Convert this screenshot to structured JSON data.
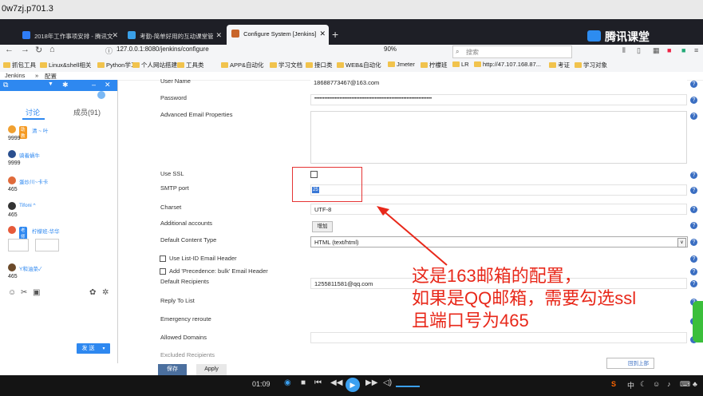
{
  "window_title": "0w7zj.p701.3",
  "tabs": [
    {
      "label": "2018年工作事项安排 - 腾讯文",
      "color": "#2f7df6"
    },
    {
      "label": "考勤-简单好用的互动课堂管",
      "color": "#3aa0e8"
    },
    {
      "label": "Configure System [Jenkins]",
      "color": "#c8652a"
    }
  ],
  "brand": "腾讯课堂",
  "address": {
    "url": "127.0.0.1:8080/jenkins/configure",
    "zoom": "90%",
    "search_placeholder": "搜索"
  },
  "bookmarks": [
    "抓包工具",
    "Linux&shell相关",
    "Python学习",
    "个人网站搭建",
    "工具类",
    "APP&自动化",
    "学习文档",
    "接口类",
    "WEB&自动化",
    "Jmeter",
    "柠檬班",
    "LR",
    "http://47.107.168.87...",
    "考证",
    "学习对象"
  ],
  "breadcrumb": {
    "root": "Jenkins",
    "sep": "»",
    "page": "配置"
  },
  "form": {
    "user_name_label": "User Name",
    "user_name_value": "18688773467@163.com",
    "password_label": "Password",
    "password_value": "••••••••••••••••••••••••••••••••••••••••••••••••••••••••••••••••••••••",
    "adv_props_label": "Advanced Email Properties",
    "use_ssl_label": "Use SSL",
    "use_ssl_checked": false,
    "smtp_port_label": "SMTP port",
    "smtp_port_value": "25",
    "charset_label": "Charset",
    "charset_value": "UTF-8",
    "additional_accounts_label": "Additional accounts",
    "add_button": "增加",
    "content_type_label": "Default Content Type",
    "content_type_value": "HTML (text/html)",
    "use_list_id_label": "Use List-ID Email Header",
    "add_precedence_label": "Add 'Precedence: bulk' Email Header",
    "recipients_label": "Default Recipients",
    "recipients_value": "1255811581@qq.com",
    "reply_to_label": "Reply To List",
    "emergency_label": "Emergency reroute",
    "allowed_domains_label": "Allowed Domains",
    "excluded_label": "Excluded Recipients",
    "save_button": "保存",
    "apply_button": "Apply",
    "back_top": "回到上部",
    "help_glyph": "?"
  },
  "annotation": [
    "这是163邮箱的配置，",
    "如果是QQ邮箱，需要勾选ssl",
    "且端口号为465"
  ],
  "chat": {
    "tab_discuss": "讨论",
    "tab_members": "成员(91)",
    "send_button": "发 送",
    "messages": [
      {
        "tag": "助教",
        "name": "清 ~ 叶",
        "text": "9999",
        "avatar_color": "#f0a030"
      },
      {
        "tag": "",
        "name": "骑着蜗牛",
        "text": "9999",
        "avatar_color": "#2a4f8f"
      },
      {
        "tag": "",
        "name": "蛋炒川~卡卡",
        "text": "465",
        "avatar_color": "#e06a3a"
      },
      {
        "tag": "",
        "name": "Tifoni ^",
        "text": "465",
        "avatar_color": "#333333"
      },
      {
        "tag": "老师",
        "name": "柠檬班-华华",
        "text": "",
        "avatar_color": "#e65a3a"
      },
      {
        "tag": "",
        "name": "Y和油菜✓",
        "text": "465",
        "avatar_color": "#6b4a2a"
      }
    ]
  },
  "video": {
    "time": "01:09"
  },
  "colors": {
    "accent": "#2e88f0",
    "annotation": "#e8281a",
    "tabbar": "#1e1f26"
  }
}
